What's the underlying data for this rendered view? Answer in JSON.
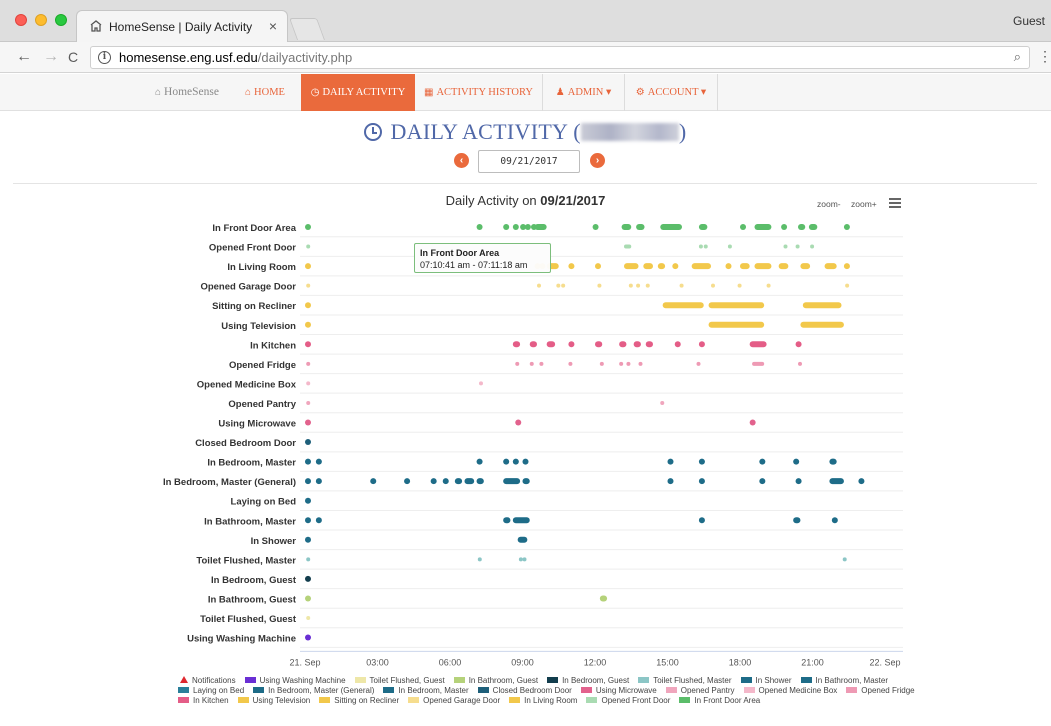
{
  "browser": {
    "tab_title": "HomeSense | Daily Activity",
    "tab_close": "×",
    "profile": "Guest",
    "url_host": "homesense.eng.usf.edu",
    "url_path": "/dailyactivity.php",
    "back": "←",
    "forward": "→",
    "reload": "C",
    "zoom_glyph": "⌕",
    "menu_glyph": "⋮"
  },
  "nav": {
    "brand": "HomeSense",
    "items": [
      {
        "label": "HOME",
        "icon": "home-icon"
      },
      {
        "label": "DAILY ACTIVITY",
        "icon": "clock-icon",
        "active": true
      },
      {
        "label": "ACTIVITY HISTORY",
        "icon": "calendar-icon"
      },
      {
        "label": "ADMIN ▾",
        "icon": "user-icon"
      },
      {
        "label": "ACCOUNT ▾",
        "icon": "cogs-icon"
      }
    ]
  },
  "page": {
    "title_prefix": "DAILY ACTIVITY (",
    "title_suffix": ")",
    "date_value": "09/21/2017",
    "prev_glyph": "‹",
    "next_glyph": "›"
  },
  "chart_controls": {
    "zoom_out": "zoom-",
    "zoom_in": "zoom+"
  },
  "tooltip": {
    "name": "In Front Door Area",
    "range": "07:10:41 am - 07:11:18 am"
  },
  "chart_data": {
    "type": "timeline",
    "title_prefix": "Daily Activity on",
    "title_date": "09/21/2017",
    "x_unit": "hours since 21 Sep 00:00",
    "xlim": [
      0,
      24
    ],
    "x_ticks": [
      {
        "value": 0,
        "label": "21. Sep"
      },
      {
        "value": 3,
        "label": "03:00"
      },
      {
        "value": 6,
        "label": "06:00"
      },
      {
        "value": 9,
        "label": "09:00"
      },
      {
        "value": 12,
        "label": "12:00"
      },
      {
        "value": 15,
        "label": "15:00"
      },
      {
        "value": 18,
        "label": "18:00"
      },
      {
        "value": 21,
        "label": "21:00"
      },
      {
        "value": 24,
        "label": "22. Sep"
      }
    ],
    "categories": [
      "In Front Door Area",
      "Opened Front Door",
      "In Living Room",
      "Opened Garage Door",
      "Sitting on Recliner",
      "Using Television",
      "In Kitchen",
      "Opened Fridge",
      "Opened Medicine Box",
      "Opened Pantry",
      "Using Microwave",
      "Closed Bedroom Door",
      "In Bedroom, Master",
      "In Bedroom, Master (General)",
      "Laying on Bed",
      "In Bathroom, Master",
      "In Shower",
      "Toilet Flushed, Master",
      "In Bedroom, Guest",
      "In Bathroom, Guest",
      "Toilet Flushed, Guest",
      "Using Washing Machine"
    ],
    "colors": {
      "In Front Door Area": "#5bbd6a",
      "Opened Front Door": "#a9dbb2",
      "In Living Room": "#f2c84b",
      "Opened Garage Door": "#f6dd8e",
      "Sitting on Recliner": "#f2c84b",
      "Using Television": "#f2c84b",
      "In Kitchen": "#e45d87",
      "Opened Fridge": "#ee9ab4",
      "Opened Medicine Box": "#f4b8ca",
      "Opened Pantry": "#f0a6bd",
      "Using Microwave": "#e2628d",
      "Closed Bedroom Door": "#1e5f7a",
      "In Bedroom, Master": "#1e6c88",
      "In Bedroom, Master (General)": "#1e6c88",
      "Laying on Bed": "#1e6c88",
      "In Bathroom, Master": "#1e6c88",
      "In Shower": "#1e6c88",
      "Toilet Flushed, Master": "#8cc6c6",
      "In Bedroom, Guest": "#123d4d",
      "In Bathroom, Guest": "#b5d27a",
      "Toilet Flushed, Guest": "#eee7a8",
      "Using Washing Machine": "#6a2fd4"
    },
    "events": {
      "In Front Door Area": [
        [
          0.0,
          0.15
        ],
        [
          7.1,
          7.3
        ],
        [
          8.2,
          8.45
        ],
        [
          8.6,
          8.8
        ],
        [
          8.9,
          9.0
        ],
        [
          9.1,
          9.25
        ],
        [
          9.35,
          9.45
        ],
        [
          9.5,
          10.0
        ],
        [
          11.9,
          12.05
        ],
        [
          13.1,
          13.5
        ],
        [
          13.7,
          14.05
        ],
        [
          14.7,
          15.6
        ],
        [
          16.3,
          16.65
        ],
        [
          18.0,
          18.25
        ],
        [
          18.6,
          19.3
        ],
        [
          19.7,
          19.9
        ],
        [
          20.4,
          20.7
        ],
        [
          20.85,
          21.2
        ],
        [
          22.3,
          22.5
        ]
      ],
      "Opened Front Door": [
        [
          0.05,
          0.1
        ],
        [
          13.2,
          13.5
        ],
        [
          16.3,
          16.4
        ],
        [
          16.5,
          16.6
        ],
        [
          17.5,
          17.6
        ],
        [
          19.8,
          19.9
        ],
        [
          20.3,
          20.4
        ],
        [
          20.9,
          21.0
        ]
      ],
      "In Living Room": [
        [
          0.0,
          0.15
        ],
        [
          9.5,
          9.6
        ],
        [
          9.7,
          9.8
        ],
        [
          10.0,
          10.5
        ],
        [
          10.9,
          11.1
        ],
        [
          12.0,
          12.2
        ],
        [
          13.2,
          13.8
        ],
        [
          14.0,
          14.4
        ],
        [
          14.6,
          14.9
        ],
        [
          15.2,
          15.4
        ],
        [
          16.0,
          16.8
        ],
        [
          17.4,
          17.6
        ],
        [
          18.0,
          18.4
        ],
        [
          18.6,
          19.3
        ],
        [
          19.6,
          20.0
        ],
        [
          20.5,
          20.9
        ],
        [
          21.5,
          22.0
        ],
        [
          22.3,
          22.5
        ]
      ],
      "Opened Garage Door": [
        [
          0.05,
          0.1
        ],
        [
          9.6,
          9.7
        ],
        [
          10.4,
          10.55
        ],
        [
          10.6,
          10.7
        ],
        [
          12.1,
          12.2
        ],
        [
          13.4,
          13.5
        ],
        [
          13.7,
          13.8
        ],
        [
          14.1,
          14.2
        ],
        [
          15.5,
          15.6
        ],
        [
          16.8,
          16.9
        ],
        [
          17.9,
          18.0
        ],
        [
          19.1,
          19.2
        ],
        [
          22.35,
          22.45
        ]
      ],
      "Sitting on Recliner": [
        [
          0.0,
          0.15
        ],
        [
          14.8,
          16.5
        ],
        [
          16.7,
          19.0
        ],
        [
          20.6,
          22.2
        ]
      ],
      "Using Television": [
        [
          0.0,
          0.15
        ],
        [
          16.7,
          19.0
        ],
        [
          20.5,
          22.3
        ]
      ],
      "In Kitchen": [
        [
          0.0,
          0.15
        ],
        [
          8.6,
          8.9
        ],
        [
          9.3,
          9.6
        ],
        [
          10.0,
          10.35
        ],
        [
          10.9,
          11.1
        ],
        [
          12.0,
          12.3
        ],
        [
          13.0,
          13.3
        ],
        [
          13.6,
          13.9
        ],
        [
          14.1,
          14.4
        ],
        [
          15.3,
          15.5
        ],
        [
          16.3,
          16.5
        ],
        [
          18.4,
          19.1
        ],
        [
          20.3,
          20.5
        ]
      ],
      "Opened Fridge": [
        [
          0.05,
          0.1
        ],
        [
          8.7,
          8.8
        ],
        [
          9.3,
          9.4
        ],
        [
          9.7,
          9.8
        ],
        [
          10.9,
          11.0
        ],
        [
          12.2,
          12.3
        ],
        [
          13.0,
          13.1
        ],
        [
          13.3,
          13.4
        ],
        [
          13.8,
          13.9
        ],
        [
          16.2,
          16.3
        ],
        [
          18.5,
          19.0
        ],
        [
          20.4,
          20.5
        ]
      ],
      "Opened Medicine Box": [
        [
          0.05,
          0.1
        ],
        [
          7.2,
          7.3
        ]
      ],
      "Opened Pantry": [
        [
          0.05,
          0.1
        ],
        [
          14.7,
          14.8
        ]
      ],
      "Using Microwave": [
        [
          0.0,
          0.15
        ],
        [
          8.7,
          8.9
        ],
        [
          18.4,
          18.6
        ]
      ],
      "Closed Bedroom Door": [
        [
          0.0,
          0.15
        ]
      ],
      "In Bedroom, Master": [
        [
          0.0,
          0.15
        ],
        [
          0.45,
          0.6
        ],
        [
          7.1,
          7.25
        ],
        [
          8.2,
          8.4
        ],
        [
          8.6,
          8.8
        ],
        [
          9.0,
          9.2
        ],
        [
          15.0,
          15.2
        ],
        [
          16.3,
          16.5
        ],
        [
          18.8,
          19.0
        ],
        [
          20.2,
          20.4
        ],
        [
          21.7,
          22.0
        ]
      ],
      "In Bedroom, Master (General)": [
        [
          0.0,
          0.15
        ],
        [
          0.45,
          0.6
        ],
        [
          2.7,
          2.9
        ],
        [
          4.1,
          4.3
        ],
        [
          5.2,
          5.4
        ],
        [
          5.7,
          5.9
        ],
        [
          6.2,
          6.5
        ],
        [
          6.6,
          7.0
        ],
        [
          7.1,
          7.4
        ],
        [
          8.2,
          8.9
        ],
        [
          9.0,
          9.3
        ],
        [
          15.0,
          15.2
        ],
        [
          16.3,
          16.5
        ],
        [
          18.8,
          19.0
        ],
        [
          20.3,
          20.5
        ],
        [
          21.7,
          22.3
        ],
        [
          22.9,
          23.1
        ]
      ],
      "Laying on Bed": [
        [
          0.0,
          0.15
        ]
      ],
      "In Bathroom, Master": [
        [
          0.0,
          0.15
        ],
        [
          0.45,
          0.6
        ],
        [
          8.2,
          8.5
        ],
        [
          8.6,
          9.3
        ],
        [
          16.3,
          16.5
        ],
        [
          20.2,
          20.5
        ],
        [
          21.8,
          22.0
        ]
      ],
      "In Shower": [
        [
          0.0,
          0.15
        ],
        [
          8.8,
          9.2
        ]
      ],
      "Toilet Flushed, Master": [
        [
          0.05,
          0.1
        ],
        [
          7.15,
          7.25
        ],
        [
          8.85,
          8.95
        ],
        [
          9.0,
          9.1
        ],
        [
          22.25,
          22.35
        ]
      ],
      "In Bedroom, Guest": [
        [
          0.0,
          0.15
        ]
      ],
      "In Bathroom, Guest": [
        [
          0.0,
          0.15
        ],
        [
          12.2,
          12.5
        ]
      ],
      "Toilet Flushed, Guest": [
        [
          0.05,
          0.1
        ]
      ],
      "Using Washing Machine": [
        [
          0.0,
          0.15
        ]
      ]
    },
    "legend": [
      {
        "label": "Notifications",
        "color": "#e0282f",
        "marker": "triangle"
      },
      {
        "label": "Using Washing Machine",
        "color": "#6a2fd4"
      },
      {
        "label": "Toilet Flushed, Guest",
        "color": "#eee7a8"
      },
      {
        "label": "In Bathroom, Guest",
        "color": "#b5d27a"
      },
      {
        "label": "In Bedroom, Guest",
        "color": "#123d4d"
      },
      {
        "label": "Toilet Flushed, Master",
        "color": "#8cc6c6"
      },
      {
        "label": "In Shower",
        "color": "#1e6c88"
      },
      {
        "label": "In Bathroom, Master",
        "color": "#1e6c88"
      },
      {
        "label": "Laying on Bed",
        "color": "#2a7f9a"
      },
      {
        "label": "In Bedroom, Master (General)",
        "color": "#1e6c88"
      },
      {
        "label": "In Bedroom, Master",
        "color": "#1e6c88"
      },
      {
        "label": "Closed Bedroom Door",
        "color": "#1e5f7a"
      },
      {
        "label": "Using Microwave",
        "color": "#e2628d"
      },
      {
        "label": "Opened Pantry",
        "color": "#f0a6bd"
      },
      {
        "label": "Opened Medicine Box",
        "color": "#f4b8ca"
      },
      {
        "label": "Opened Fridge",
        "color": "#ee9ab4"
      },
      {
        "label": "In Kitchen",
        "color": "#e45d87"
      },
      {
        "label": "Using Television",
        "color": "#f2c84b"
      },
      {
        "label": "Sitting on Recliner",
        "color": "#f2c84b"
      },
      {
        "label": "Opened Garage Door",
        "color": "#f6dd8e"
      },
      {
        "label": "In Living Room",
        "color": "#f2c84b"
      },
      {
        "label": "Opened Front Door",
        "color": "#a9dbb2"
      },
      {
        "label": "In Front Door Area",
        "color": "#5bbd6a"
      }
    ]
  }
}
